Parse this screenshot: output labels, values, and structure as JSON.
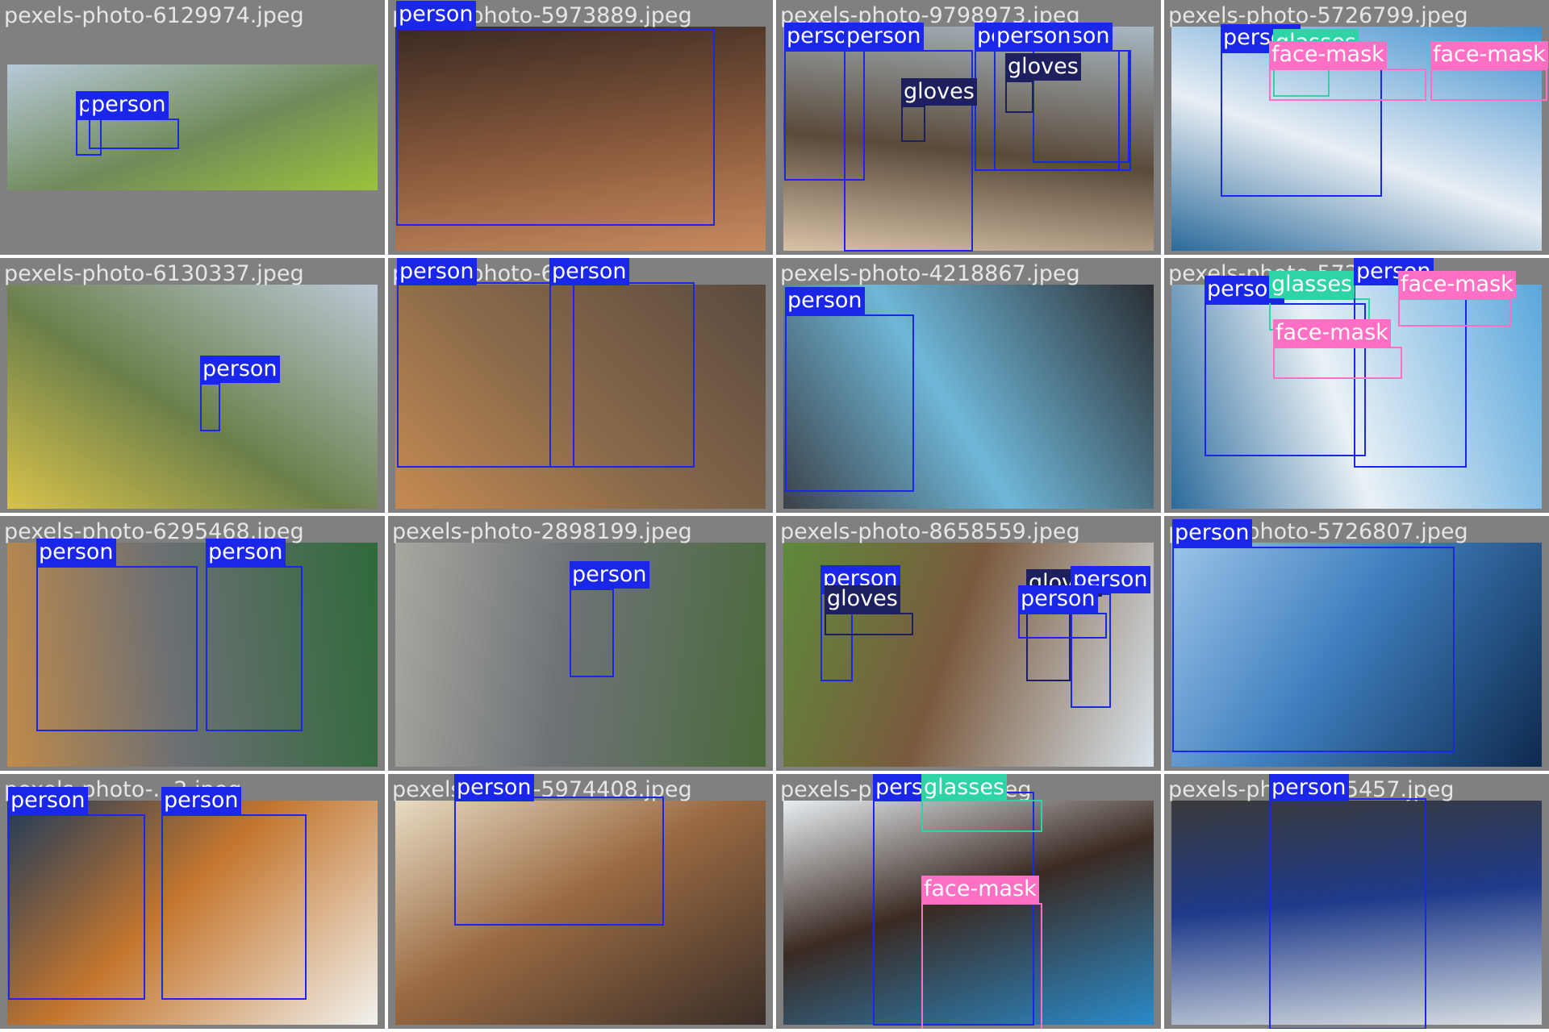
{
  "colors": {
    "person": "#1a27e8",
    "gloves": "#1e1f5e",
    "glasses": "#2ed3a6",
    "face-mask": "#ff6fc4",
    "helmet": "#00c8d8",
    "tile_background": "#808080"
  },
  "cells": [
    {
      "filename": "pexels-photo-6129974.jpeg",
      "scene": "rice-terrace-landscape",
      "wide": true,
      "photo_colors": [
        "#b7c9d8",
        "#6f8b5a",
        "#9cc23a"
      ],
      "labels": [
        "person",
        "person"
      ]
    },
    {
      "filename": "pexels-photo-5973889.jpeg",
      "scene": "tape-measure-on-wood",
      "photo_colors": [
        "#3a2a22",
        "#8a5a3c",
        "#c78a5e"
      ],
      "labels": [
        "person"
      ]
    },
    {
      "filename": "pexels-photo-9798973.jpeg",
      "scene": "field-workers",
      "photo_colors": [
        "#a8b8c2",
        "#5a4a3a",
        "#d9c3a8"
      ],
      "labels": [
        "person",
        "person",
        "person",
        "person",
        "person",
        "gloves",
        "gloves"
      ]
    },
    {
      "filename": "pexels-photo-5726799.jpeg",
      "scene": "lab-two-scientists",
      "photo_colors": [
        "#3f8fcf",
        "#e8eef4",
        "#2b6a9a"
      ],
      "labels": [
        "person",
        "glasses",
        "face-mask",
        "face-mask"
      ]
    },
    {
      "filename": "pexels-photo-6130337.jpeg",
      "scene": "terraced-hills",
      "photo_colors": [
        "#bcc8d6",
        "#6b7f4a",
        "#d8c24a"
      ],
      "labels": [
        "person"
      ]
    },
    {
      "filename": "pexels-photo-6...jpeg",
      "scene": "coffee-cup-hands",
      "photo_colors": [
        "#5a4a3e",
        "#8a6a4a",
        "#c68a52"
      ],
      "labels": [
        "person",
        "person"
      ]
    },
    {
      "filename": "pexels-photo-4218867.jpeg",
      "scene": "car-cleaning",
      "photo_colors": [
        "#2a2e33",
        "#6fb7d8",
        "#3b4148"
      ],
      "labels": [
        "person"
      ]
    },
    {
      "filename": "pexels-photo-572...jpeg",
      "scene": "lab-microscope",
      "photo_colors": [
        "#5aa7dc",
        "#eaf1f6",
        "#2b6a9a"
      ],
      "labels": [
        "person",
        "glasses",
        "person",
        "face-mask",
        "face-mask"
      ]
    },
    {
      "filename": "pexels-photo-6295468.jpeg",
      "scene": "aprons-crossed-arms",
      "photo_colors": [
        "#2f6a3a",
        "#6b6f74",
        "#c08a4a"
      ],
      "labels": [
        "person",
        "person"
      ]
    },
    {
      "filename": "pexels-photo-2898199.jpeg",
      "scene": "utility-bucket-truck",
      "photo_colors": [
        "#4a6a3a",
        "#6f7378",
        "#a8a8a0"
      ],
      "labels": [
        "person"
      ]
    },
    {
      "filename": "pexels-photo-8658559.jpeg",
      "scene": "tobacco-field",
      "photo_colors": [
        "#d9e4ec",
        "#7a5a3e",
        "#5e8a3a"
      ],
      "labels": [
        "person",
        "gloves",
        "person",
        "person",
        "gloves"
      ]
    },
    {
      "filename": "pexels-photo-5726807.jpeg",
      "scene": "microscope-closeup",
      "photo_colors": [
        "#0e2a4e",
        "#3f7fbf",
        "#9cc4e8"
      ],
      "labels": [
        "person"
      ]
    },
    {
      "filename": "pexels-photo-...2.jpeg",
      "scene": "cafe-tablet",
      "photo_colors": [
        "#f2f2ee",
        "#c4762e",
        "#1e3a5a"
      ],
      "labels": [
        "person",
        "person"
      ]
    },
    {
      "filename": "pexels-photo-5974408.jpeg",
      "scene": "woodworking-chisel",
      "photo_colors": [
        "#3a2e28",
        "#9a6a42",
        "#e8dcc4"
      ],
      "labels": [
        "person"
      ]
    },
    {
      "filename": "pexels-photo-...83.jpeg",
      "scene": "face-mask-portrait",
      "photo_colors": [
        "#2a8ac8",
        "#3a2a22",
        "#e8eef2"
      ],
      "labels": [
        "person",
        "glasses",
        "face-mask"
      ]
    },
    {
      "filename": "pexels-photo-985457.jpeg",
      "scene": "mechanic-engine",
      "photo_colors": [
        "#d8dee2",
        "#1e3a8a",
        "#3a3a3a"
      ],
      "labels": [
        "person"
      ]
    }
  ]
}
